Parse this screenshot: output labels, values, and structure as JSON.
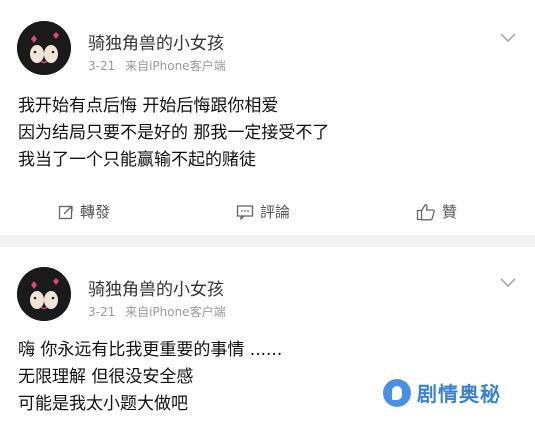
{
  "posts": [
    {
      "username": "骑独角兽的小女孩",
      "date": "3-21",
      "source": "来自iPhone客户端",
      "lines": [
        "我开始有点后悔 开始后悔跟你相爱",
        "因为结局只要不是好的 那我一定接受不了",
        "我当了一个只能赢输不起的赌徒"
      ],
      "actions": {
        "repost": "轉發",
        "comment": "評論",
        "like": "贊"
      }
    },
    {
      "username": "骑独角兽的小女孩",
      "date": "3-21",
      "source": "来自iPhone客户端",
      "lines": [
        "嗨 你永远有比我更重要的事情 ......",
        "无限理解 但很没安全感",
        "可能是我太小题大做吧"
      ]
    }
  ],
  "watermark": {
    "text": "剧情奥秘"
  },
  "colors": {
    "accent": "#3b82d6",
    "card": "#ffffff",
    "background": "#f2f2f2"
  }
}
